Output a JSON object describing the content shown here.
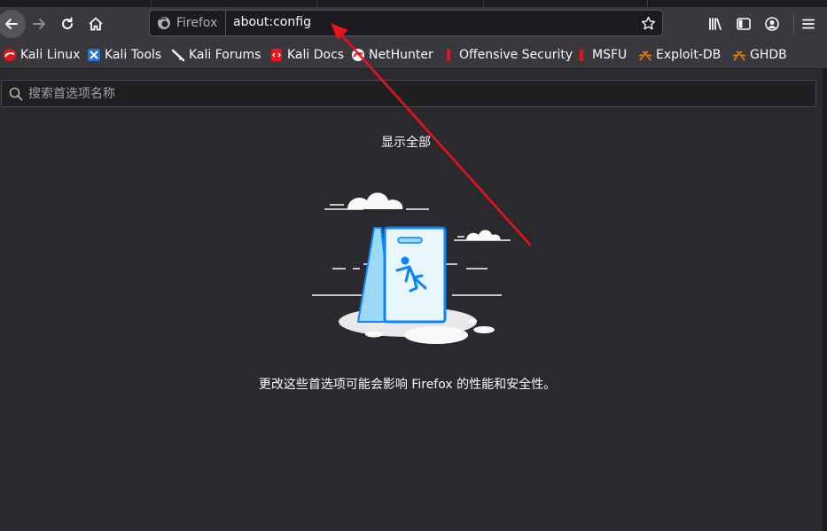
{
  "navbar": {
    "identity_label": "Firefox",
    "url": "about:config"
  },
  "bookmarks": [
    {
      "label": "Kali Linux",
      "icon": "kali-linux-icon"
    },
    {
      "label": "Kali Tools",
      "icon": "kali-tools-icon"
    },
    {
      "label": "Kali Forums",
      "icon": "kali-forums-icon"
    },
    {
      "label": "Kali Docs",
      "icon": "kali-docs-icon"
    },
    {
      "label": "NetHunter",
      "icon": "nethunter-icon"
    },
    {
      "label": "Offensive Security",
      "icon": "offensive-security-icon"
    },
    {
      "label": "MSFU",
      "icon": "msfu-icon"
    },
    {
      "label": "Exploit-DB",
      "icon": "exploit-db-icon"
    },
    {
      "label": "GHDB",
      "icon": "ghdb-icon"
    }
  ],
  "config": {
    "search_placeholder": "搜索首选项名称",
    "show_all_label": "显示全部",
    "warning_text": "更改这些首选项可能会影响 Firefox 的性能和安全性。"
  },
  "colors": {
    "background": "#2a2a2e",
    "toolbar": "#38383d",
    "annotation_arrow": "#e8131b",
    "illustration_blue": "#0a84ff"
  }
}
